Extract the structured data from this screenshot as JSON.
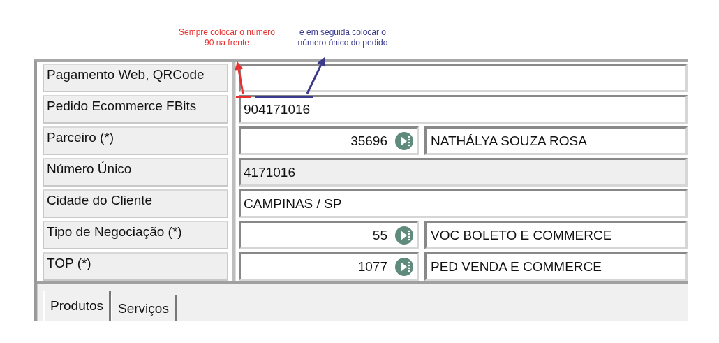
{
  "annotations": [
    {
      "text": "Sempre colocar o número 90 na frente",
      "color": "#e8312f"
    },
    {
      "text": "e em seguida colocar o número único do pedido",
      "color": "#3a3a8c"
    }
  ],
  "form": {
    "rows": [
      {
        "label": "Pagamento Web, QRCode",
        "kind": "text",
        "disabled": false
      },
      {
        "label": "Pedido Ecommerce FBits",
        "kind": "text",
        "value": "904171016",
        "disabled": false
      },
      {
        "label": "Parceiro (*)",
        "kind": "lookup",
        "code": "35696",
        "description": "NATHÁLYA SOUZA ROSA"
      },
      {
        "label": "Número Único",
        "kind": "text",
        "value": "4171016",
        "disabled": true
      },
      {
        "label": "Cidade do Cliente",
        "kind": "text",
        "value": "CAMPINAS / SP",
        "disabled": false
      },
      {
        "label": "Tipo de Negociação (*)",
        "kind": "lookup",
        "code": "55",
        "description": "VOC BOLETO E COMMERCE"
      },
      {
        "label": "TOP (*)",
        "kind": "lookup",
        "code": "1077",
        "description": "PED VENDA E COMMERCE"
      }
    ]
  },
  "tabs": [
    {
      "label": "Produtos",
      "selected": true
    },
    {
      "label": "Serviços",
      "selected": false
    }
  ]
}
